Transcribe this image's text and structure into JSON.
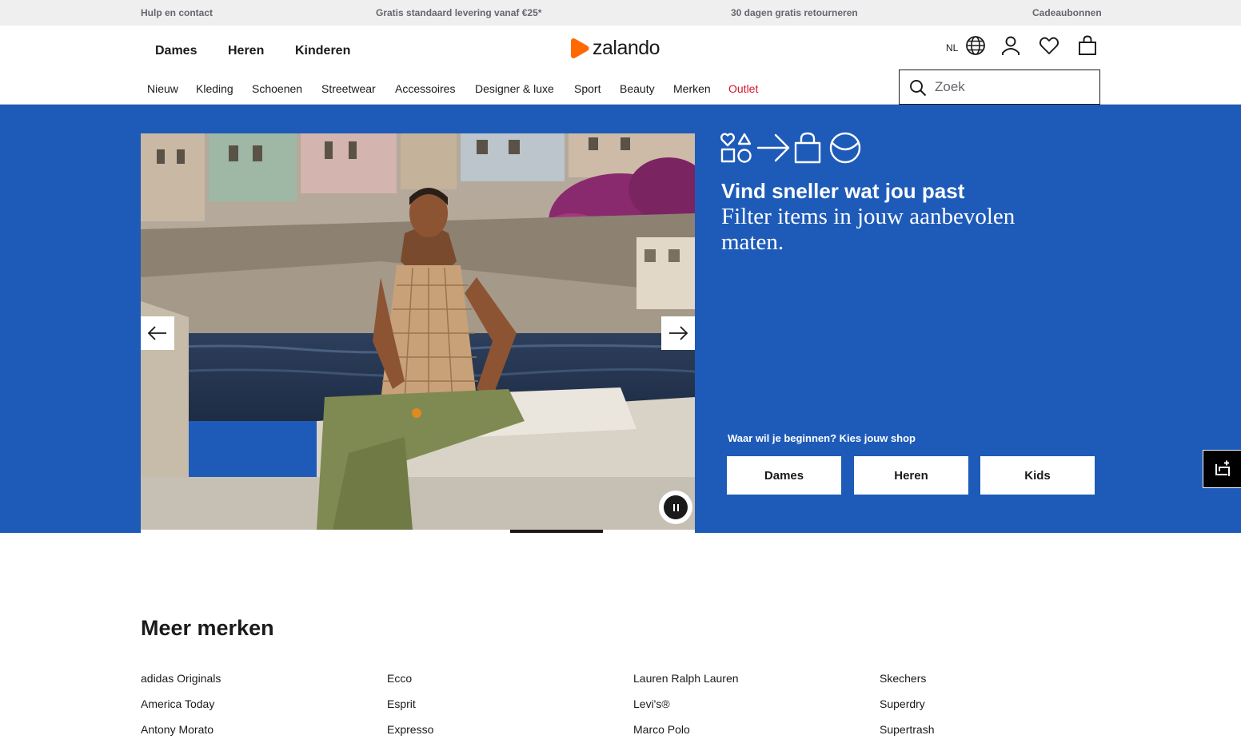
{
  "topbar": {
    "help": "Hulp en contact",
    "shipping": "Gratis standaard levering vanaf €25*",
    "returns": "30 dagen gratis retourneren",
    "giftcards": "Cadeaubonnen"
  },
  "header": {
    "gender_tabs": [
      "Dames",
      "Heren",
      "Kinderen"
    ],
    "logo_text": "zalando",
    "language": "NL",
    "categories": [
      "Nieuw",
      "Kleding",
      "Schoenen",
      "Streetwear",
      "Accessoires",
      "Designer & luxe",
      "Sport",
      "Beauty",
      "Merken",
      "Outlet"
    ],
    "search_placeholder": "Zoek"
  },
  "hero": {
    "title": "Vind sneller wat jou past",
    "subtitle": "Filter items in jouw aanbevolen maten.",
    "shop_label": "Waar wil je beginnen? Kies jouw shop",
    "shop_buttons": [
      "Dames",
      "Heren",
      "Kids"
    ]
  },
  "brands": {
    "title": "Meer merken",
    "columns": [
      [
        "adidas Originals",
        "America Today",
        "Antony Morato"
      ],
      [
        "Ecco",
        "Esprit",
        "Expresso"
      ],
      [
        "Lauren Ralph Lauren",
        "Levi's®",
        "Marco Polo"
      ],
      [
        "Skechers",
        "Superdry",
        "Supertrash"
      ]
    ]
  },
  "colors": {
    "hero_blue": "#1e5bb9",
    "brand_orange": "#ff6900",
    "outlet_red": "#d4152c",
    "topbar_bg": "#efeff0"
  },
  "icons": [
    "globe-icon",
    "user-icon",
    "heart-icon",
    "bag-icon",
    "search-icon",
    "arrow-left-icon",
    "arrow-right-icon",
    "pause-icon",
    "feedback-icon"
  ]
}
